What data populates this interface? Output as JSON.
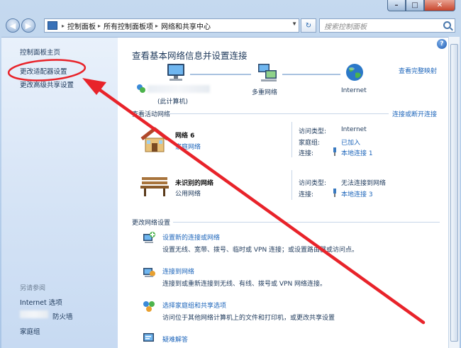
{
  "window": {
    "controls": {
      "minimize": "–",
      "maximize": "□",
      "close": "✕"
    }
  },
  "nav": {
    "back_glyph": "◀",
    "forward_glyph": "▶",
    "breadcrumb": [
      "控制面板",
      "所有控制面板项",
      "网络和共享中心"
    ],
    "breadcrumb_separator": "▸",
    "refresh_glyph": "↻",
    "search_placeholder": "搜索控制面板"
  },
  "left_pane": {
    "links": [
      "控制面板主页",
      "更改适配器设置",
      "更改高级共享设置"
    ],
    "see_also_heading": "另请参阅",
    "see_also": [
      "Internet 选项",
      "防火墙",
      "家庭组"
    ]
  },
  "main": {
    "title": "查看基本网络信息并设置连接",
    "full_map_link": "查看完整映射",
    "map": {
      "computer_label": "(此计算机)",
      "middle_label": "多重网络",
      "internet_label": "Internet"
    },
    "active_heading": "查看活动网络",
    "connect_disconnect_link": "连接或断开连接",
    "networks": [
      {
        "name": "网络  6",
        "type": "家庭网络",
        "access_label": "访问类型:",
        "access_value": "Internet",
        "homegroup_label": "家庭组:",
        "homegroup_value": "已加入",
        "connection_label": "连接:",
        "connection_value": "本地连接 1"
      },
      {
        "name": "未识别的网络",
        "type": "公用网络",
        "access_label": "访问类型:",
        "access_value": "无法连接到网络",
        "connection_label": "连接:",
        "connection_value": "本地连接 3"
      }
    ],
    "change_heading": "更改网络设置",
    "tasks": [
      {
        "title": "设置新的连接或网络",
        "desc": "设置无线、宽带、拨号、临时或 VPN 连接；或设置路由器或访问点。"
      },
      {
        "title": "连接到网络",
        "desc": "连接到或重新连接到无线、有线、拨号或 VPN 网络连接。"
      },
      {
        "title": "选择家庭组和共享选项",
        "desc": "访问位于其他网络计算机上的文件和打印机，或更改共享设置"
      },
      {
        "title": "疑难解答",
        "desc": ""
      }
    ]
  },
  "colors": {
    "annotation_red": "#e8232a",
    "link_blue": "#1e66bb",
    "text_dark": "#1e395b"
  },
  "icons": {
    "help": "?"
  }
}
